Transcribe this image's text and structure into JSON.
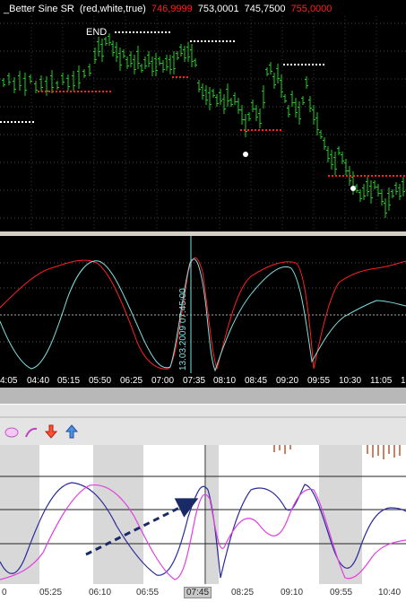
{
  "price_chart": {
    "indicator_name": "_Better Sine SR",
    "indicator_params": "(red,white,true)",
    "values": [
      "746,9999",
      "753,0001",
      "745,7500",
      "755,0000"
    ],
    "value_colors": [
      "#ff2020",
      "#ffffff",
      "#ffffff",
      "#ff2020"
    ],
    "end_label": "END",
    "bar_color": "#22cc22",
    "resistance_color": "#ffffff",
    "support_color": "#ff2020"
  },
  "oscillator": {
    "vertical_marker_label": "13.03.2009 07:45:00",
    "line1_color": "#ff2020",
    "line2_color": "#7fe0e0"
  },
  "time_axis": {
    "labels": [
      "4:05",
      "04:40",
      "05:15",
      "05:50",
      "06:25",
      "07:00",
      "07:35",
      "08:10",
      "08:45",
      "09:20",
      "09:55",
      "10:30",
      "11:05",
      "1"
    ]
  },
  "toolbar": {
    "icons": [
      "ellipse-tool-icon",
      "curve-tool-icon",
      "arrow-down-icon",
      "arrow-up-icon"
    ]
  },
  "bottom_chart": {
    "axis_labels": [
      "0",
      "05:25",
      "06:10",
      "06:55",
      "07:45",
      "08:25",
      "09:10",
      "09:55",
      "10:40"
    ],
    "highlighted_label": "07:45",
    "line1_color": "#2a2a9a",
    "line2_color": "#e040e0",
    "annotation_color": "#1a2a66"
  }
}
